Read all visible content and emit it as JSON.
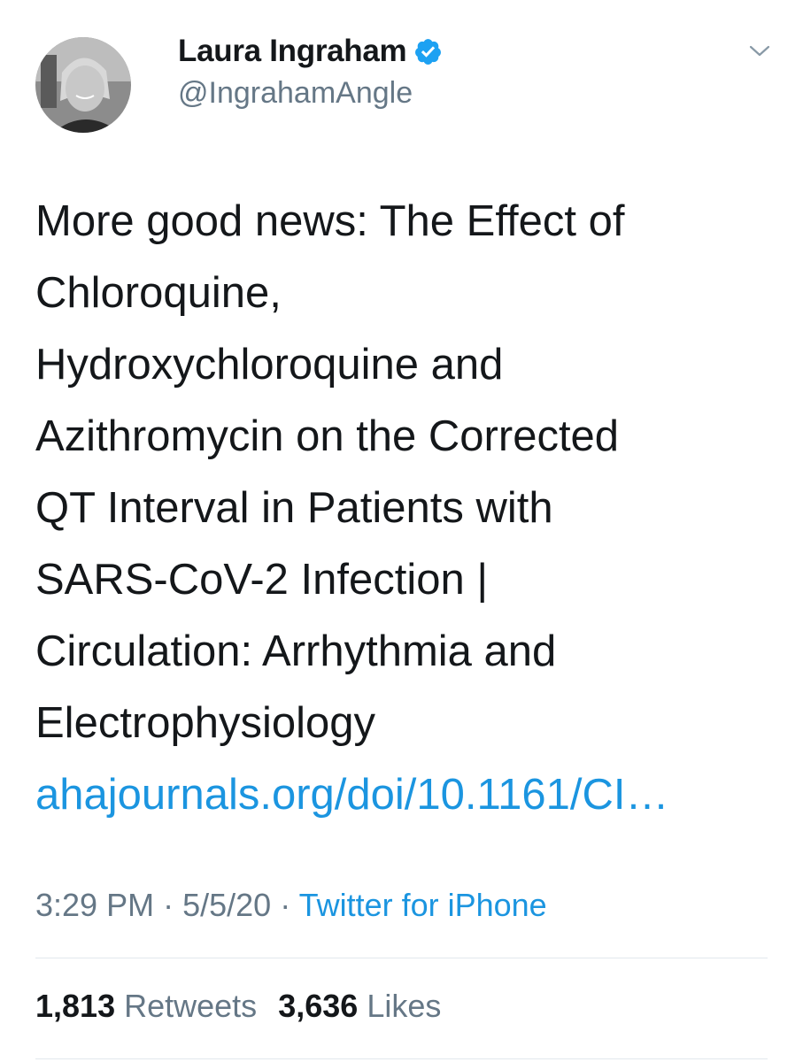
{
  "author": {
    "display_name": "Laura Ingraham",
    "handle": "@IngrahamAngle",
    "verified": true,
    "avatar_icon": "profile-photo"
  },
  "tweet": {
    "text_lines": [
      "More good news: The Effect of",
      "Chloroquine,",
      "Hydroxychloroquine and",
      "Azithromycin on the Corrected",
      "QT Interval in Patients with",
      "SARS-CoV-2 Infection |",
      "Circulation: Arrhythmia and",
      "Electrophysiology"
    ],
    "link_text": "ahajournals.org/doi/10.1161/CI…"
  },
  "meta": {
    "time": "3:29 PM",
    "separator": "·",
    "date": "5/5/20",
    "source": "Twitter for iPhone"
  },
  "stats": {
    "retweets_count": "1,813",
    "retweets_label": "Retweets",
    "likes_count": "3,636",
    "likes_label": "Likes"
  },
  "colors": {
    "text": "#14171a",
    "secondary": "#657786",
    "link": "#1b95e0",
    "verified": "#1da1f2",
    "divider": "#e1e8ed"
  },
  "icons": {
    "verified": "verified-badge-icon",
    "menu": "chevron-down-icon"
  }
}
